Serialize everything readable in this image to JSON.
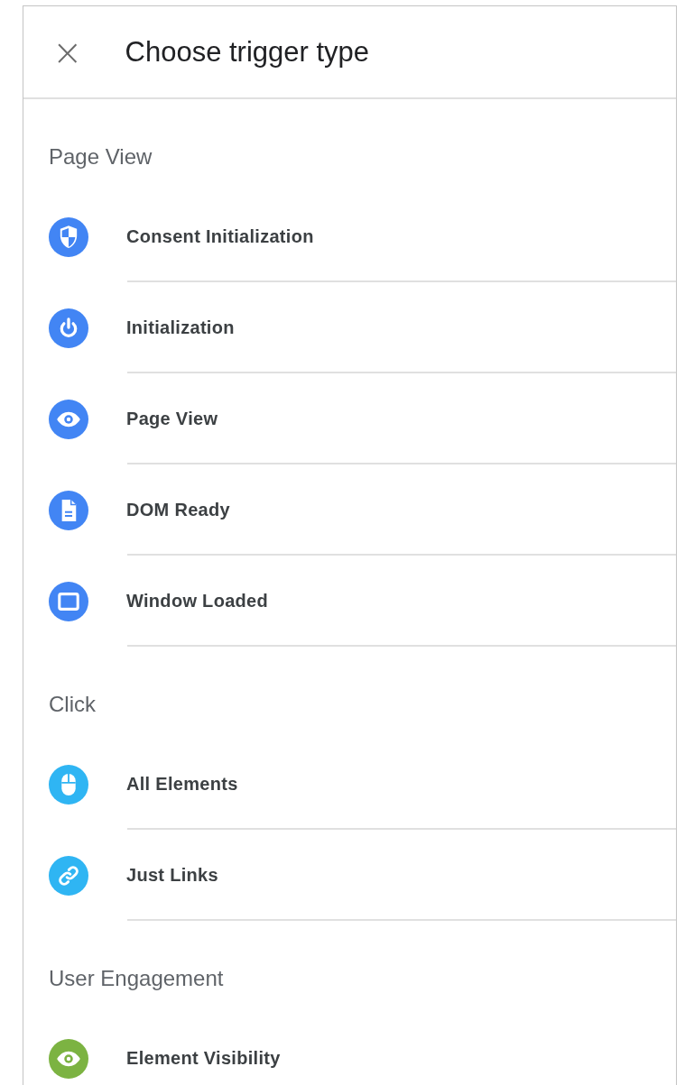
{
  "dialog": {
    "title": "Choose trigger type",
    "close": "×"
  },
  "sections": [
    {
      "heading": "Page View",
      "items": [
        {
          "label": "Consent Initialization",
          "kind": "shield",
          "color": "#4285f4"
        },
        {
          "label": "Initialization",
          "kind": "power",
          "color": "#4285f4"
        },
        {
          "label": "Page View",
          "kind": "eye",
          "color": "#4285f4"
        },
        {
          "label": "DOM Ready",
          "kind": "document",
          "color": "#4285f4"
        },
        {
          "label": "Window Loaded",
          "kind": "window",
          "color": "#4285f4"
        }
      ]
    },
    {
      "heading": "Click",
      "items": [
        {
          "label": "All Elements",
          "kind": "mouse",
          "color": "#2fb5f3"
        },
        {
          "label": "Just Links",
          "kind": "link",
          "color": "#2fb5f3"
        }
      ]
    },
    {
      "heading": "User Engagement",
      "items": [
        {
          "label": "Element Visibility",
          "kind": "eye",
          "color": "#7cb342"
        }
      ]
    }
  ]
}
